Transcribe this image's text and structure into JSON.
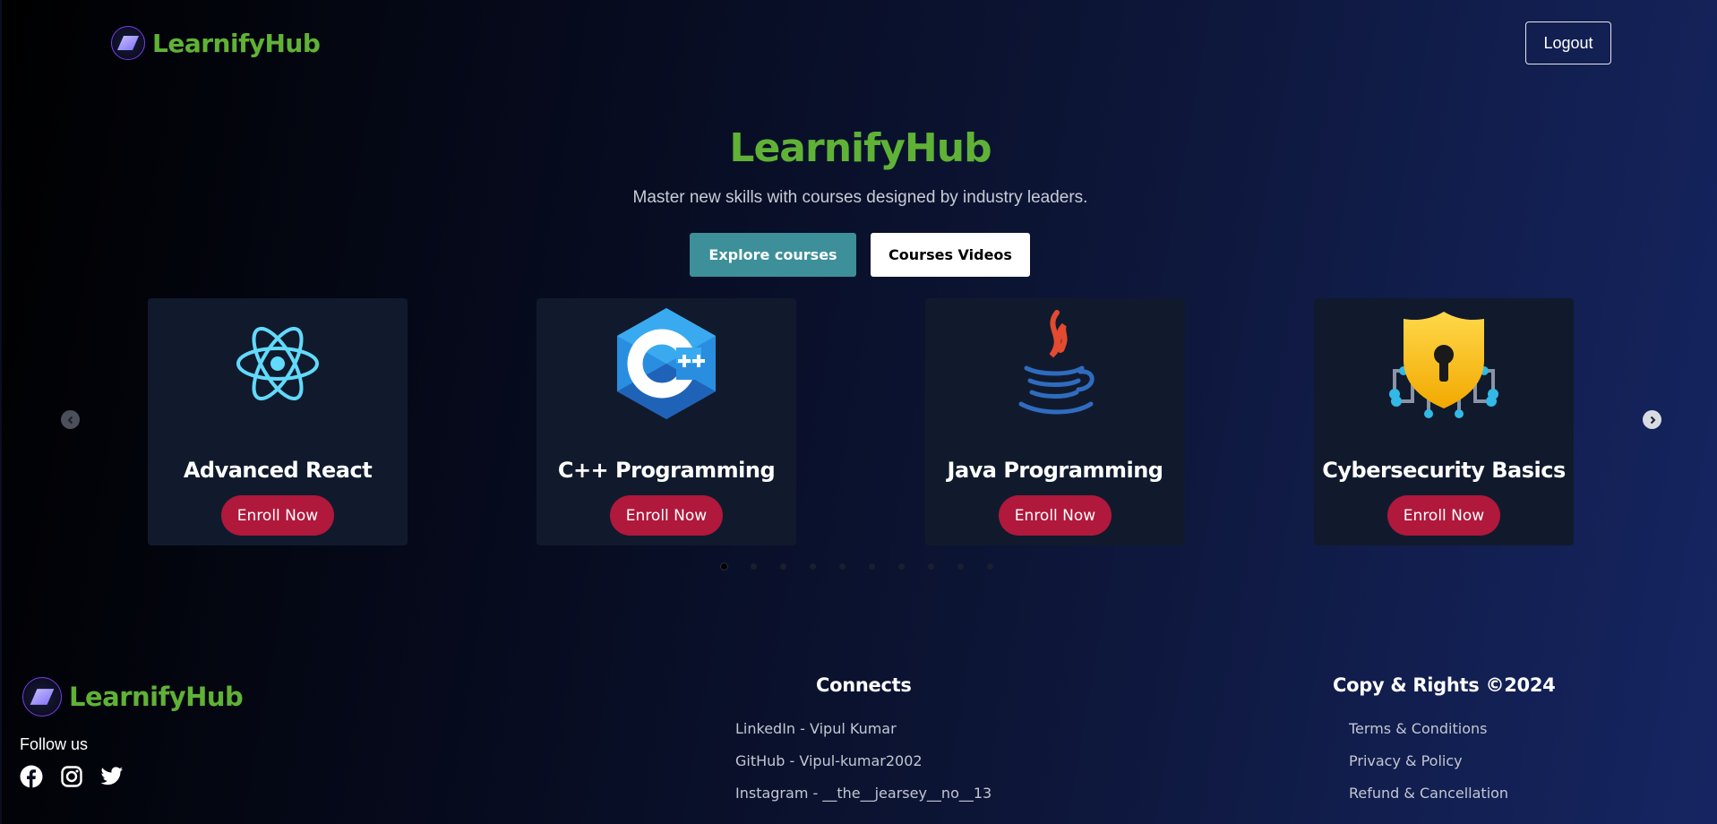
{
  "header": {
    "brand_name": "LearnifyHub",
    "logout_label": "Logout"
  },
  "hero": {
    "title": "LearnifyHub",
    "subtitle": "Master new skills with courses designed by industry leaders.",
    "explore_label": "Explore courses",
    "videos_label": "Courses Videos"
  },
  "carousel": {
    "courses": [
      {
        "name": "Advanced React",
        "cta": "Enroll Now",
        "icon": "react-icon"
      },
      {
        "name": "C++ Programming",
        "cta": "Enroll Now",
        "icon": "cpp-icon"
      },
      {
        "name": "Java Programming",
        "cta": "Enroll Now",
        "icon": "java-icon"
      },
      {
        "name": "Cybersecurity Basics",
        "cta": "Enroll Now",
        "icon": "shield-lock-icon"
      }
    ],
    "dot_count": 10,
    "active_dot": 0
  },
  "footer": {
    "brand_name": "LearnifyHub",
    "follow_label": "Follow us",
    "socials": [
      "facebook-icon",
      "instagram-icon",
      "twitter-icon"
    ],
    "connects": {
      "title": "Connects",
      "links": [
        "LinkedIn - Vipul Kumar",
        "GitHub - Vipul-kumar2002",
        "Instagram - __the__jearsey__no__13"
      ]
    },
    "rights": {
      "title": "Copy & Rights ©2024",
      "links": [
        "Terms & Conditions",
        "Privacy & Policy",
        "Refund & Cancellation"
      ]
    }
  },
  "colors": {
    "brand_green": "#5fb236",
    "explore_teal": "#3d8f99",
    "enroll_red": "#b0183c",
    "card_bg": "#111a2d"
  }
}
